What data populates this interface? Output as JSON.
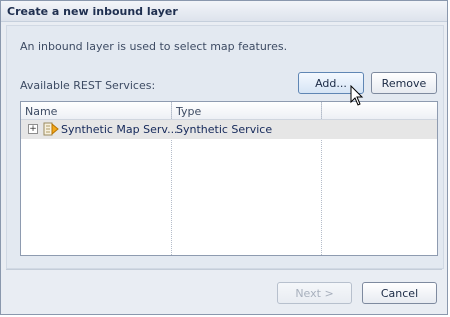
{
  "dialog": {
    "title": "Create a new inbound layer",
    "description": "An inbound layer is  used to select map features.",
    "services_label": "Available REST Services:"
  },
  "buttons": {
    "add": "Add...",
    "remove": "Remove",
    "next": "Next >",
    "cancel": "Cancel"
  },
  "table": {
    "columns": [
      "Name",
      "Type"
    ],
    "rows": [
      {
        "name": "Synthetic Map Serv...",
        "type": "Synthetic Service",
        "expander": "+",
        "icon": "service-icon"
      }
    ]
  }
}
